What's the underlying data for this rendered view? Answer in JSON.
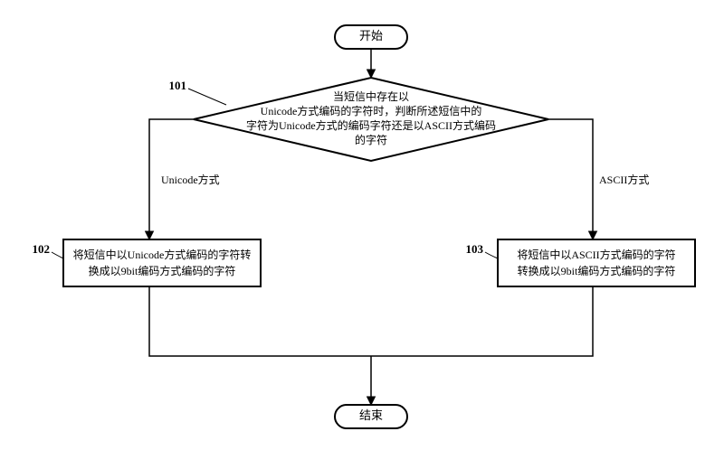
{
  "flowchart": {
    "start": "开始",
    "end": "结束",
    "decision": {
      "id": "101",
      "line1": "当短信中存在以",
      "line2": "Unicode方式编码的字符时，判断所述短信中的",
      "line3": "字符为Unicode方式的编码字符还是以ASCII方式编码",
      "line4": "的字符"
    },
    "branch_left_label": "Unicode方式",
    "branch_right_label": "ASCII方式",
    "process_left": {
      "id": "102",
      "line1": "将短信中以Unicode方式编码的字符转",
      "line2": "换成以9bit编码方式编码的字符"
    },
    "process_right": {
      "id": "103",
      "line1": "将短信中以ASCII方式编码的字符",
      "line2": "转换成以9bit编码方式编码的字符"
    }
  }
}
